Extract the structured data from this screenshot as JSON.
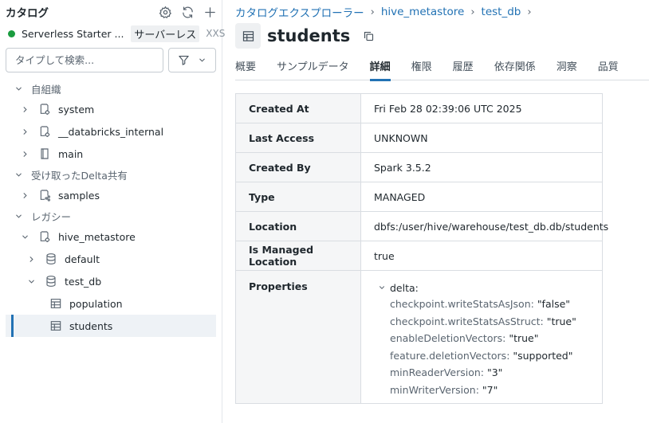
{
  "sidebar": {
    "title": "カタログ",
    "warehouse": {
      "name": "Serverless Starter ...",
      "type": "サーバーレス",
      "size": "XXS",
      "status_color": "#1a9c3f"
    },
    "search_placeholder": "タイプして検索...",
    "tree": [
      {
        "label": "自組織",
        "kind": "section",
        "expanded": true
      },
      {
        "label": "system",
        "kind": "catalog",
        "expanded": false
      },
      {
        "label": "__databricks_internal",
        "kind": "catalog",
        "expanded": false
      },
      {
        "label": "main",
        "kind": "catalog",
        "expanded": false
      },
      {
        "label": "受け取ったDelta共有",
        "kind": "section",
        "expanded": true
      },
      {
        "label": "samples",
        "kind": "shared-catalog",
        "expanded": false
      },
      {
        "label": "レガシー",
        "kind": "section",
        "expanded": true
      },
      {
        "label": "hive_metastore",
        "kind": "catalog",
        "expanded": true
      },
      {
        "label": "default",
        "kind": "schema",
        "expanded": false
      },
      {
        "label": "test_db",
        "kind": "schema",
        "expanded": true
      },
      {
        "label": "population",
        "kind": "table"
      },
      {
        "label": "students",
        "kind": "table",
        "selected": true
      }
    ]
  },
  "breadcrumb": [
    "カタログエクスプローラー",
    "hive_metastore",
    "test_db"
  ],
  "page": {
    "title": "students",
    "icon": "table-icon"
  },
  "tabs": [
    {
      "label": "概要",
      "active": false
    },
    {
      "label": "サンプルデータ",
      "active": false
    },
    {
      "label": "詳細",
      "active": true
    },
    {
      "label": "権限",
      "active": false
    },
    {
      "label": "履歴",
      "active": false
    },
    {
      "label": "依存関係",
      "active": false
    },
    {
      "label": "洞察",
      "active": false
    },
    {
      "label": "品質",
      "active": false
    }
  ],
  "details": [
    {
      "key": "Created At",
      "value": "Fri Feb 28 02:39:06 UTC 2025"
    },
    {
      "key": "Last Access",
      "value": "UNKNOWN"
    },
    {
      "key": "Created By",
      "value": "Spark 3.5.2"
    },
    {
      "key": "Type",
      "value": "MANAGED"
    },
    {
      "key": "Location",
      "value": "dbfs:/user/hive/warehouse/test_db.db/students"
    },
    {
      "key": "Is Managed Location",
      "value": "true"
    }
  ],
  "properties": {
    "key": "Properties",
    "group": "delta:",
    "items": [
      {
        "k": "checkpoint.writeStatsAsJson",
        "v": "\"false\""
      },
      {
        "k": "checkpoint.writeStatsAsStruct",
        "v": "\"true\""
      },
      {
        "k": "enableDeletionVectors",
        "v": "\"true\""
      },
      {
        "k": "feature.deletionVectors",
        "v": "\"supported\""
      },
      {
        "k": "minReaderVersion",
        "v": "\"3\""
      },
      {
        "k": "minWriterVersion",
        "v": "\"7\""
      }
    ]
  },
  "colors": {
    "accent": "#2272b4",
    "selection_bg": "#eef2f6"
  }
}
